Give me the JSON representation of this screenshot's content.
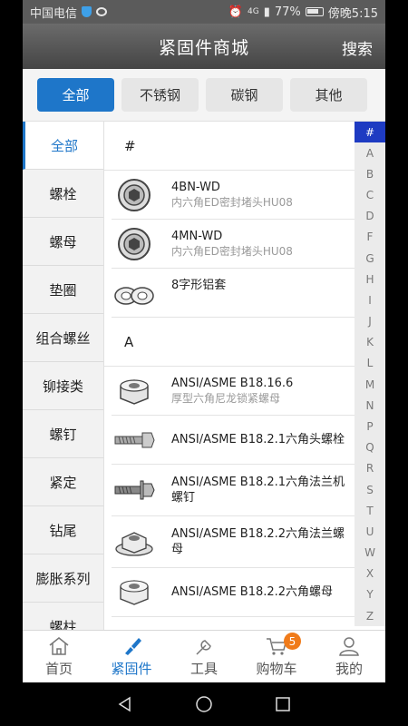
{
  "status_bar": {
    "carrier": "中国电信",
    "signal_label": "4G",
    "battery": "77%",
    "time": "傍晚5:15"
  },
  "header": {
    "title": "紧固件商城",
    "search_label": "搜索"
  },
  "filters": [
    {
      "label": "全部",
      "active": true
    },
    {
      "label": "不锈钢",
      "active": false
    },
    {
      "label": "碳钢",
      "active": false
    },
    {
      "label": "其他",
      "active": false
    }
  ],
  "categories": [
    "全部",
    "螺栓",
    "螺母",
    "垫圈",
    "组合螺丝",
    "铆接类",
    "螺钉",
    "紧定",
    "钻尾",
    "膨胀系列",
    "螺柱"
  ],
  "sections": [
    {
      "header": "#",
      "items": [
        {
          "name": "4BN-WD",
          "sub": "内六角ED密封堵头HU08",
          "icon": "socket-plug"
        },
        {
          "name": "4MN-WD",
          "sub": "内六角ED密封堵头HU08",
          "icon": "socket-plug"
        },
        {
          "name": "8字形铝套",
          "sub": "",
          "icon": "figure8-sleeve"
        }
      ]
    },
    {
      "header": "A",
      "items": [
        {
          "name": "ANSI/ASME B18.16.6",
          "sub": "厚型六角尼龙锁紧螺母",
          "icon": "nylon-nut"
        },
        {
          "name": "ANSI/ASME B18.2.1六角头螺栓",
          "sub": "",
          "icon": "hex-bolt"
        },
        {
          "name": "ANSI/ASME B18.2.1六角法兰机螺钉",
          "sub": "",
          "icon": "flange-bolt"
        },
        {
          "name": "ANSI/ASME B18.2.2六角法兰螺母",
          "sub": "",
          "icon": "flange-nut"
        },
        {
          "name": "ANSI/ASME B18.2.2六角螺母",
          "sub": "",
          "icon": "hex-nut"
        }
      ]
    }
  ],
  "index_letters": [
    "#",
    "A",
    "B",
    "C",
    "D",
    "F",
    "G",
    "H",
    "I",
    "J",
    "K",
    "L",
    "M",
    "N",
    "P",
    "Q",
    "R",
    "S",
    "T",
    "U",
    "W",
    "X",
    "Y",
    "Z"
  ],
  "bottom_nav": [
    {
      "label": "首页",
      "icon": "home-icon",
      "active": false
    },
    {
      "label": "紧固件",
      "icon": "brush-icon",
      "active": true
    },
    {
      "label": "工具",
      "icon": "wrench-icon",
      "active": false
    },
    {
      "label": "购物车",
      "icon": "cart-icon",
      "active": false,
      "badge": "5"
    },
    {
      "label": "我的",
      "icon": "user-icon",
      "active": false
    }
  ],
  "colors": {
    "accent": "#1e76c9",
    "index_active": "#1e3bc2",
    "badge": "#f07b1a"
  }
}
